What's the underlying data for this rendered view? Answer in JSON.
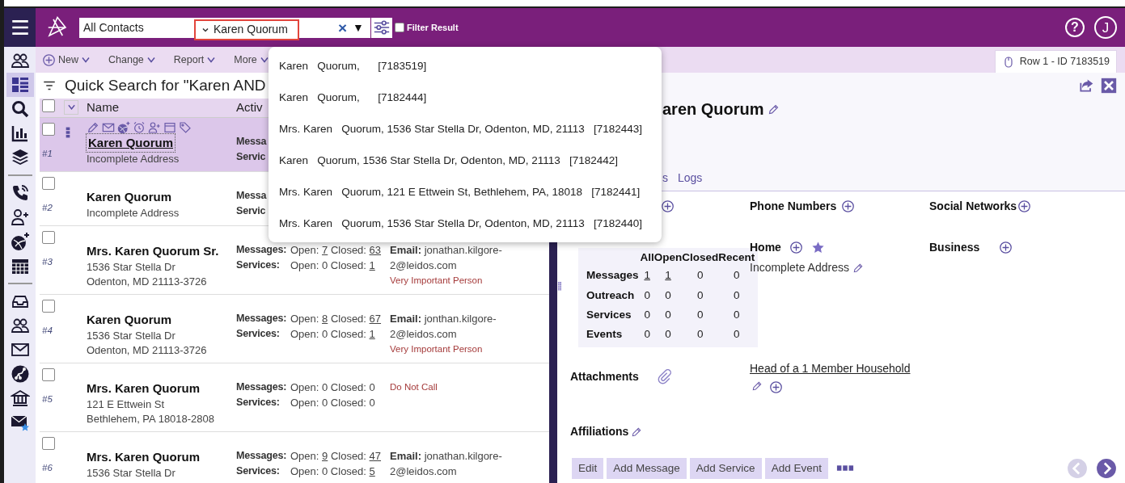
{
  "top_bar": {
    "scope": "All Contacts",
    "search_value": "Karen Quorum",
    "clear_glyph": "×",
    "dropdown_glyph": "▼",
    "filter_result": {
      "label": "Filter Result",
      "checked": false
    },
    "help_glyph": "?",
    "avatar_initial": "J"
  },
  "suggestions": [
    {
      "text": "Karen   Quorum,      [7183519]"
    },
    {
      "text": "Karen   Quorum,      [7182444]"
    },
    {
      "text": "Mrs. Karen   Quorum, 1536 Star Stella Dr, Odenton, MD, 21113   [7182443]"
    },
    {
      "text": "Karen   Quorum, 1536 Star Stella Dr, Odenton, MD, 21113   [7182442]"
    },
    {
      "text": "Mrs. Karen   Quorum, 121 E Ettwein St, Bethlehem, PA, 18018   [7182441]"
    },
    {
      "text": "Mrs. Karen   Quorum, 1536 Star Stella Dr, Odenton, MD, 21113   [7182440]"
    }
  ],
  "rail_groups": [
    [
      {
        "kind": "people",
        "selected": false
      },
      {
        "kind": "list",
        "selected": true
      },
      {
        "kind": "search",
        "selected": false
      },
      {
        "kind": "chart",
        "selected": false
      },
      {
        "kind": "layers",
        "selected": false
      }
    ],
    [
      {
        "kind": "phone",
        "selected": false
      },
      {
        "kind": "person-add",
        "selected": false
      },
      {
        "kind": "ball",
        "selected": false
      },
      {
        "kind": "calendar",
        "selected": false
      }
    ],
    [
      {
        "kind": "inbox",
        "selected": false
      },
      {
        "kind": "people",
        "selected": false
      },
      {
        "kind": "envelope",
        "selected": false
      },
      {
        "kind": "nodes",
        "selected": false
      },
      {
        "kind": "bank",
        "selected": false
      },
      {
        "kind": "envelope-star",
        "selected": false
      }
    ]
  ],
  "toolbar": {
    "menus": [
      {
        "label": "New",
        "add": true
      },
      {
        "label": "Change",
        "add": false
      },
      {
        "label": "Report",
        "add": false
      },
      {
        "label": "More",
        "add": false
      }
    ],
    "record_tab": "Row 1 - ID 7183519"
  },
  "results": {
    "title": "Quick Search for \"Karen AND",
    "select_all_checked": false,
    "columns": [
      "Name",
      "Activ"
    ],
    "rows": [
      {
        "number": "#1",
        "selected": true,
        "checked": false,
        "name": "Karen Quorum",
        "address": [
          "Incomplete Address"
        ],
        "activity": [
          {
            "label": "Messa"
          },
          {
            "label": "Servic"
          }
        ]
      },
      {
        "number": "#2",
        "selected": false,
        "checked": false,
        "name": "Karen Quorum",
        "address": [
          "Incomplete Address"
        ],
        "activity": [
          {
            "label": "Messa"
          },
          {
            "label": "Servic"
          }
        ]
      },
      {
        "number": "#3",
        "selected": false,
        "checked": false,
        "name": "Mrs. Karen Quorum Sr.",
        "address": [
          "1536 Star Stella Dr",
          "Odenton, MD 21113-3726"
        ],
        "activity": [
          {
            "label": "Messages:",
            "parts": [
              {
                "text": "Open: ",
                "link": false
              },
              {
                "text": "7",
                "link": true
              },
              {
                "text": " Closed: ",
                "link": false
              },
              {
                "text": "63",
                "link": true
              }
            ]
          },
          {
            "label": "Services:",
            "parts": [
              {
                "text": "Open: 0 Closed: ",
                "link": false
              },
              {
                "text": "1",
                "link": true
              }
            ]
          }
        ],
        "email": {
          "label": "Email:",
          "value": "jonathan.kilgore-2@leidos.com"
        },
        "flag": "Very Important Person"
      },
      {
        "number": "#4",
        "selected": false,
        "checked": false,
        "name": "Karen Quorum",
        "address": [
          "1536 Star Stella Dr",
          "Odenton, MD 21113-3726"
        ],
        "activity": [
          {
            "label": "Messages:",
            "parts": [
              {
                "text": "Open: ",
                "link": false
              },
              {
                "text": "8",
                "link": true
              },
              {
                "text": " Closed: ",
                "link": false
              },
              {
                "text": "67",
                "link": true
              }
            ]
          },
          {
            "label": "Services:",
            "parts": [
              {
                "text": "Open: 0 Closed: ",
                "link": false
              },
              {
                "text": "1",
                "link": true
              }
            ]
          }
        ],
        "email": {
          "label": "Email:",
          "value": "jonthan.kilgore-2@leidos.com"
        },
        "flag": "Very Important Person"
      },
      {
        "number": "#5",
        "selected": false,
        "checked": false,
        "name": "Mrs. Karen Quorum",
        "address": [
          "121 E Ettwein St",
          "Bethlehem, PA 18018-2808"
        ],
        "activity": [
          {
            "label": "Messages:",
            "parts": [
              {
                "text": "Open: 0 Closed: 0",
                "link": false
              }
            ]
          },
          {
            "label": "Services:",
            "parts": [
              {
                "text": "Open: 0 Closed: 0",
                "link": false
              }
            ]
          }
        ],
        "flag": "Do Not Call"
      },
      {
        "number": "#6",
        "selected": false,
        "checked": false,
        "name": "Mrs. Karen Quorum",
        "address": [
          "1536 Star Stella Dr"
        ],
        "activity": [
          {
            "label": "Messages:",
            "parts": [
              {
                "text": "Open: ",
                "link": false
              },
              {
                "text": "9",
                "link": true
              },
              {
                "text": " Closed: ",
                "link": false
              },
              {
                "text": "47",
                "link": true
              }
            ]
          },
          {
            "label": "Services:",
            "parts": [
              {
                "text": "Open: 0 Closed: ",
                "link": false
              },
              {
                "text": "5",
                "link": true
              }
            ]
          }
        ],
        "email": {
          "label": "Email:",
          "value": "jonathan.kilgore-2@leidos.com"
        }
      }
    ]
  },
  "detail": {
    "title": "aren Quorum",
    "tabs": [
      "s",
      "Logs"
    ],
    "sections": [
      "Phone Numbers",
      "Social Networks"
    ],
    "stats": {
      "columns": [
        "All",
        "Open",
        "Closed",
        "Recent"
      ],
      "rows": [
        {
          "label": "Messages",
          "values": [
            {
              "text": "1",
              "link": true
            },
            {
              "text": "1",
              "link": true
            },
            {
              "text": "0",
              "link": false
            },
            {
              "text": "0",
              "link": false
            }
          ]
        },
        {
          "label": "Outreach",
          "values": [
            {
              "text": "0",
              "link": false
            },
            {
              "text": "0",
              "link": false
            },
            {
              "text": "0",
              "link": false
            },
            {
              "text": "0",
              "link": false
            }
          ]
        },
        {
          "label": "Services",
          "values": [
            {
              "text": "0",
              "link": false
            },
            {
              "text": "0",
              "link": false
            },
            {
              "text": "0",
              "link": false
            },
            {
              "text": "0",
              "link": false
            }
          ]
        },
        {
          "label": "Events",
          "values": [
            {
              "text": "0",
              "link": false
            },
            {
              "text": "0",
              "link": false
            },
            {
              "text": "0",
              "link": false
            },
            {
              "text": "0",
              "link": false
            }
          ]
        }
      ]
    },
    "addresses": [
      {
        "label": "Home",
        "primary": true,
        "lines": [
          "Incomplete Address"
        ]
      },
      {
        "label": "Business",
        "primary": false
      }
    ],
    "attachments": "Attachments",
    "household": "Head of a 1 Member Household",
    "affiliations": "Affiliations",
    "actions": [
      "Edit",
      "Add Message",
      "Add Service",
      "Add Event"
    ],
    "prev_disabled": true,
    "next_disabled": false
  }
}
